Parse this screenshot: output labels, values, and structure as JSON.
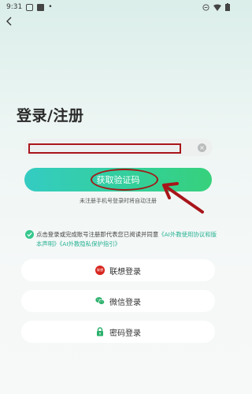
{
  "status_bar": {
    "time": "9:31"
  },
  "title": "登录/注册",
  "phone": {
    "value": "",
    "placeholder": ""
  },
  "get_code_label": "获取验证码",
  "hint": "未注册手机号登录时将自动注册",
  "agreement": {
    "prefix": "点击登录或完成账号注册即代表您已阅读并同意",
    "link_terms": "《AI外教使用协议和版本声明》",
    "link_privacy": "《AI外教隐私保护指引》"
  },
  "options": {
    "lenovo": "联想登录",
    "wechat": "微信登录",
    "password": "密码登录",
    "lenovo_badge_text": "联想"
  },
  "colors": {
    "accent": "#34cf98",
    "annotation": "#a8161a",
    "lenovo": "#d7261f",
    "wechat": "#2ab06b"
  }
}
